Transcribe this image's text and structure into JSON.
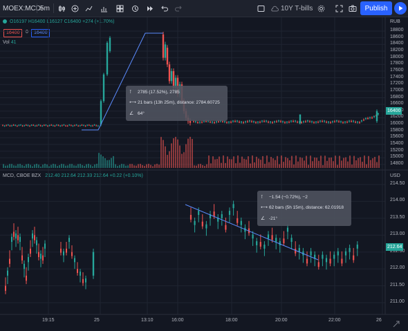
{
  "toolbar": {
    "symbol": "MOEX:MCD-",
    "interval": "5m",
    "compare_symbol": "10Y T-bills",
    "publish_label": "Publish"
  },
  "pane1": {
    "legend": {
      "open": "O16197",
      "high": "H16400",
      "low": "L16127",
      "close": "C16400",
      "change": "+274 (+1.70%)"
    },
    "price_box": "16400",
    "price_box_sep": "0",
    "price_box_2": "16400",
    "vol_label": "Vol",
    "vol_value": "41",
    "currency": "RUB",
    "last_price": "16400",
    "tooltip": {
      "line1": "2785 (17.52%), 2785",
      "line2": "21 bars (13h 25m), distance: 2784.60725",
      "line3": "64°"
    }
  },
  "pane2": {
    "legend_symbol": "MCD, CBOE BZX",
    "legend_values": "212.40  212.64  212.33  212.64  +0.22 (+0.10%)",
    "currency": "USD",
    "last_price": "212.64",
    "tooltip": {
      "line1": "−1.54 (−0.72%), −2",
      "line2": "62 bars (5h 15m), distance: 62.01918",
      "line3": "-21°"
    }
  },
  "chart_data": [
    {
      "type": "line",
      "title": "MOEX:MCD- 5m",
      "y_ticks": [
        "18800",
        "18600",
        "18400",
        "18200",
        "18000",
        "17800",
        "17600",
        "17400",
        "17200",
        "17000",
        "16800",
        "16600",
        "16400",
        "16200",
        "16000",
        "15800",
        "15600",
        "15400",
        "15200",
        "15000",
        "14800"
      ],
      "ylim": [
        14750,
        18950
      ],
      "candles_close_approx": [
        15900,
        15950,
        15950,
        15950,
        15950,
        15950,
        15950,
        15950,
        15950,
        15950,
        15950,
        15950,
        15950,
        15950,
        15950,
        15950,
        15950,
        15950,
        15950,
        15950,
        15950,
        15950,
        15950,
        15950,
        15950,
        15950,
        15950,
        15950,
        15950,
        15950,
        15950,
        15950,
        15950,
        15950,
        15950,
        15950,
        15950,
        16700,
        17600,
        18400,
        18300,
        18400,
        18100,
        17400,
        16500,
        16100,
        16050,
        16050,
        16100,
        16100,
        16050,
        16100,
        16080,
        16100,
        16120,
        16100,
        16150,
        16120,
        16150,
        16100,
        16120,
        16100,
        16150,
        16150,
        16150,
        16100,
        16120,
        16150,
        16300,
        16250,
        16400
      ],
      "volume_scale_note": "",
      "up_color": "#26a69a",
      "down_color": "#ef5350"
    },
    {
      "type": "line",
      "title": "MCD, CBOE BZX",
      "y_ticks": [
        "214.50",
        "214.00",
        "213.50",
        "213.00",
        "212.50",
        "212.00",
        "211.50",
        "211.00"
      ],
      "ylim": [
        210.75,
        214.75
      ],
      "x_ticks": [
        "19:15",
        "25",
        "13:10",
        "16:00",
        "18:00",
        "20:00",
        "22:00",
        "26"
      ],
      "up_color": "#26a69a",
      "down_color": "#ef5350"
    }
  ]
}
